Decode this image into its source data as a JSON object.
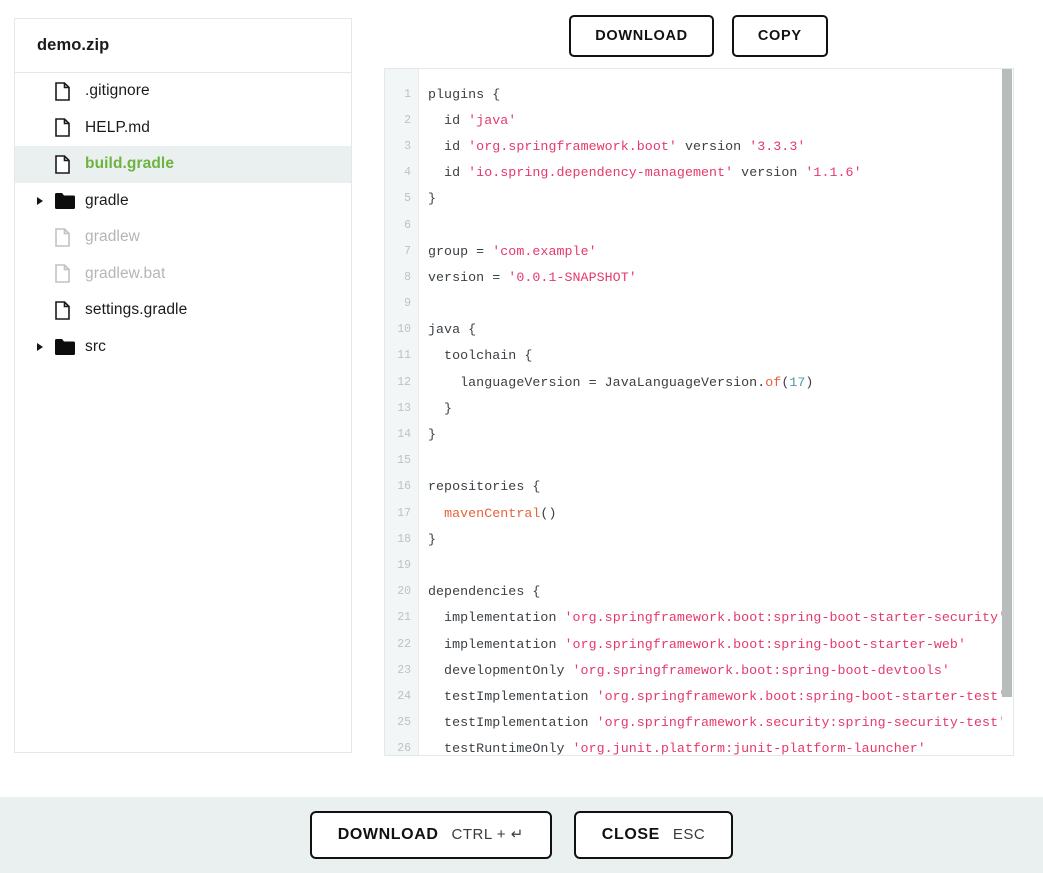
{
  "sidebar": {
    "title": "demo.zip",
    "items": [
      {
        "label": ".gitignore",
        "type": "file",
        "state": "normal",
        "expandable": false
      },
      {
        "label": "HELP.md",
        "type": "file",
        "state": "normal",
        "expandable": false
      },
      {
        "label": "build.gradle",
        "type": "file",
        "state": "selected",
        "expandable": false
      },
      {
        "label": "gradle",
        "type": "folder",
        "state": "normal",
        "expandable": true
      },
      {
        "label": "gradlew",
        "type": "file",
        "state": "muted",
        "expandable": false
      },
      {
        "label": "gradlew.bat",
        "type": "file",
        "state": "muted",
        "expandable": false
      },
      {
        "label": "settings.gradle",
        "type": "file",
        "state": "normal",
        "expandable": false
      },
      {
        "label": "src",
        "type": "folder",
        "state": "normal",
        "expandable": true
      }
    ]
  },
  "top_actions": {
    "download_label": "DOWNLOAD",
    "copy_label": "COPY"
  },
  "footer": {
    "download_label": "DOWNLOAD",
    "download_hint": "CTRL + ↵",
    "close_label": "CLOSE",
    "close_hint": "ESC"
  },
  "colors": {
    "accent_green": "#6db33f",
    "string": "#e5396b",
    "function": "#e8603c",
    "number": "#4a9aa8",
    "code_text": "#3b4045",
    "line_number": "#bac4c4",
    "panel_border": "#e3e8e8",
    "selected_row": "#eaf0f0",
    "gutter_bg": "#f2f6f6",
    "footer_bg": "#eaf0f0",
    "scrollbar_thumb": "#b7bcbc"
  },
  "code": {
    "language": "gradle",
    "filename": "build.gradle",
    "first_visible_line": 1,
    "last_visible_line": 26,
    "lines": [
      {
        "n": 1,
        "tokens": [
          {
            "t": "plugins {",
            "c": "kw"
          }
        ]
      },
      {
        "n": 2,
        "tokens": [
          {
            "t": "  id ",
            "c": "kw"
          },
          {
            "t": "'java'",
            "c": "str"
          }
        ]
      },
      {
        "n": 3,
        "tokens": [
          {
            "t": "  id ",
            "c": "kw"
          },
          {
            "t": "'org.springframework.boot'",
            "c": "str"
          },
          {
            "t": " version ",
            "c": "kw"
          },
          {
            "t": "'3.3.3'",
            "c": "str"
          }
        ]
      },
      {
        "n": 4,
        "tokens": [
          {
            "t": "  id ",
            "c": "kw"
          },
          {
            "t": "'io.spring.dependency-management'",
            "c": "str"
          },
          {
            "t": " version ",
            "c": "kw"
          },
          {
            "t": "'1.1.6'",
            "c": "str"
          }
        ]
      },
      {
        "n": 5,
        "tokens": [
          {
            "t": "}",
            "c": "kw"
          }
        ]
      },
      {
        "n": 6,
        "tokens": []
      },
      {
        "n": 7,
        "tokens": [
          {
            "t": "group = ",
            "c": "kw"
          },
          {
            "t": "'com.example'",
            "c": "str"
          }
        ]
      },
      {
        "n": 8,
        "tokens": [
          {
            "t": "version = ",
            "c": "kw"
          },
          {
            "t": "'0.0.1-SNAPSHOT'",
            "c": "str"
          }
        ]
      },
      {
        "n": 9,
        "tokens": []
      },
      {
        "n": 10,
        "tokens": [
          {
            "t": "java {",
            "c": "kw"
          }
        ]
      },
      {
        "n": 11,
        "tokens": [
          {
            "t": "  toolchain {",
            "c": "kw"
          }
        ]
      },
      {
        "n": 12,
        "tokens": [
          {
            "t": "    languageVersion = JavaLanguageVersion.",
            "c": "kw"
          },
          {
            "t": "of",
            "c": "fn"
          },
          {
            "t": "(",
            "c": "kw"
          },
          {
            "t": "17",
            "c": "num"
          },
          {
            "t": ")",
            "c": "kw"
          }
        ]
      },
      {
        "n": 13,
        "tokens": [
          {
            "t": "  }",
            "c": "kw"
          }
        ]
      },
      {
        "n": 14,
        "tokens": [
          {
            "t": "}",
            "c": "kw"
          }
        ]
      },
      {
        "n": 15,
        "tokens": []
      },
      {
        "n": 16,
        "tokens": [
          {
            "t": "repositories {",
            "c": "kw"
          }
        ]
      },
      {
        "n": 17,
        "tokens": [
          {
            "t": "  ",
            "c": "kw"
          },
          {
            "t": "mavenCentral",
            "c": "fn"
          },
          {
            "t": "()",
            "c": "kw"
          }
        ]
      },
      {
        "n": 18,
        "tokens": [
          {
            "t": "}",
            "c": "kw"
          }
        ]
      },
      {
        "n": 19,
        "tokens": []
      },
      {
        "n": 20,
        "tokens": [
          {
            "t": "dependencies {",
            "c": "kw"
          }
        ]
      },
      {
        "n": 21,
        "tokens": [
          {
            "t": "  implementation ",
            "c": "kw"
          },
          {
            "t": "'org.springframework.boot:spring-boot-starter-security'",
            "c": "str"
          }
        ]
      },
      {
        "n": 22,
        "tokens": [
          {
            "t": "  implementation ",
            "c": "kw"
          },
          {
            "t": "'org.springframework.boot:spring-boot-starter-web'",
            "c": "str"
          }
        ]
      },
      {
        "n": 23,
        "tokens": [
          {
            "t": "  developmentOnly ",
            "c": "kw"
          },
          {
            "t": "'org.springframework.boot:spring-boot-devtools'",
            "c": "str"
          }
        ]
      },
      {
        "n": 24,
        "tokens": [
          {
            "t": "  testImplementation ",
            "c": "kw"
          },
          {
            "t": "'org.springframework.boot:spring-boot-starter-test'",
            "c": "str"
          }
        ]
      },
      {
        "n": 25,
        "tokens": [
          {
            "t": "  testImplementation ",
            "c": "kw"
          },
          {
            "t": "'org.springframework.security:spring-security-test'",
            "c": "str"
          }
        ]
      },
      {
        "n": 26,
        "tokens": [
          {
            "t": "  testRuntimeOnly ",
            "c": "kw"
          },
          {
            "t": "'org.junit.platform:junit-platform-launcher'",
            "c": "str"
          }
        ]
      }
    ]
  }
}
